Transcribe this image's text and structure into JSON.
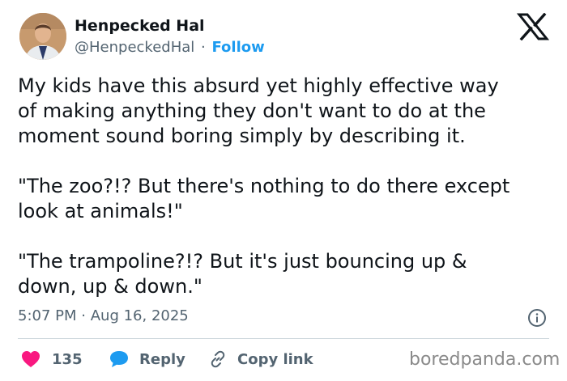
{
  "author": {
    "name": "Henpecked Hal",
    "handle": "@HenpeckedHal",
    "separator": "·",
    "follow_label": "Follow"
  },
  "tweet": {
    "paragraphs": [
      "My kids have this absurd yet highly effective way\nof making anything they don't want to do at the\nmoment sound boring simply by describing it.",
      "\"The zoo?!? But there's nothing to do there except\nlook at animals!\"",
      "\"The trampoline?!? But it's just bouncing up &\ndown, up & down.\""
    ],
    "time": "5:07 PM",
    "date": "Aug 16, 2025",
    "separator": "·"
  },
  "actions": {
    "like_count": "135",
    "reply_label": "Reply",
    "copy_label": "Copy link"
  },
  "watermark": "boredpanda.com",
  "icons": {
    "avatar": "avatar",
    "platform_logo": "x-logo-icon",
    "info": "info-icon",
    "like": "heart-icon",
    "reply": "speech-bubble-icon",
    "copy": "link-icon"
  },
  "colors": {
    "text": "#0f1419",
    "secondary": "#536471",
    "accent": "#1d9bf0",
    "like": "#f91880",
    "divider": "#cfd9de"
  }
}
